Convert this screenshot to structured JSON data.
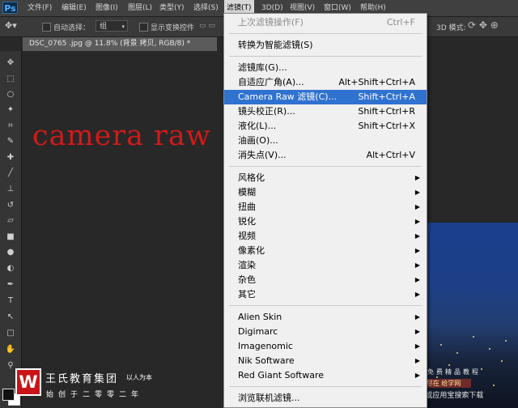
{
  "app": {
    "logo": "Ps"
  },
  "menubar": {
    "items": [
      "文件(F)",
      "编辑(E)",
      "图像(I)",
      "图层(L)",
      "类型(Y)",
      "选择(S)",
      "滤镜(T)",
      "3D(D)",
      "视图(V)",
      "窗口(W)",
      "帮助(H)"
    ],
    "active": "滤镜(T)"
  },
  "options": {
    "auto_select_label": "自动选择：",
    "group_value": "组",
    "show_transform_label": "显示变换控件",
    "mode_3d": "3D 模式:"
  },
  "document": {
    "tab_title": "DSC_0765 .jpg @ 11.8% (背景 拷贝, RGB/8) *",
    "overlay_text": "camera raw"
  },
  "filter_menu": {
    "items": [
      {
        "label": "上次滤镜操作(F)",
        "shortcut": "Ctrl+F",
        "disabled": true
      },
      {
        "sep": true
      },
      {
        "label": "转换为智能滤镜(S)",
        "shortcut": ""
      },
      {
        "sep": true
      },
      {
        "label": "滤镜库(G)...",
        "shortcut": ""
      },
      {
        "label": "自适应广角(A)...",
        "shortcut": "Alt+Shift+Ctrl+A"
      },
      {
        "label": "Camera Raw 滤镜(C)...",
        "shortcut": "Shift+Ctrl+A",
        "highlighted": true
      },
      {
        "label": "镜头校正(R)...",
        "shortcut": "Shift+Ctrl+R"
      },
      {
        "label": "液化(L)...",
        "shortcut": "Shift+Ctrl+X"
      },
      {
        "label": "油画(O)...",
        "shortcut": ""
      },
      {
        "label": "消失点(V)...",
        "shortcut": "Alt+Ctrl+V"
      },
      {
        "sep": true
      },
      {
        "label": "风格化",
        "submenu": true
      },
      {
        "label": "模糊",
        "submenu": true
      },
      {
        "label": "扭曲",
        "submenu": true
      },
      {
        "label": "锐化",
        "submenu": true
      },
      {
        "label": "视频",
        "submenu": true
      },
      {
        "label": "像素化",
        "submenu": true
      },
      {
        "label": "渲染",
        "submenu": true
      },
      {
        "label": "杂色",
        "submenu": true
      },
      {
        "label": "其它",
        "submenu": true
      },
      {
        "sep": true
      },
      {
        "label": "Alien Skin",
        "submenu": true
      },
      {
        "label": "Digimarc",
        "submenu": true
      },
      {
        "label": "Imagenomic",
        "submenu": true
      },
      {
        "label": "Nik Software",
        "submenu": true
      },
      {
        "label": "Red Giant Software",
        "submenu": true
      },
      {
        "sep": true
      },
      {
        "label": "浏览联机滤镜...",
        "shortcut": ""
      }
    ]
  },
  "watermark": {
    "brand_initial": "W",
    "brand_name": "王氏教育集团",
    "motto": "以人为本",
    "since": "始创于二零零二年",
    "right_line1": "全网最全免费精品教程",
    "right_line2": "尽在 给学网",
    "right_line3": "AppStore或应用宝搜索下载"
  },
  "colors": {
    "highlight": "#2f72d0",
    "overlay_text": "#d11a1a"
  }
}
